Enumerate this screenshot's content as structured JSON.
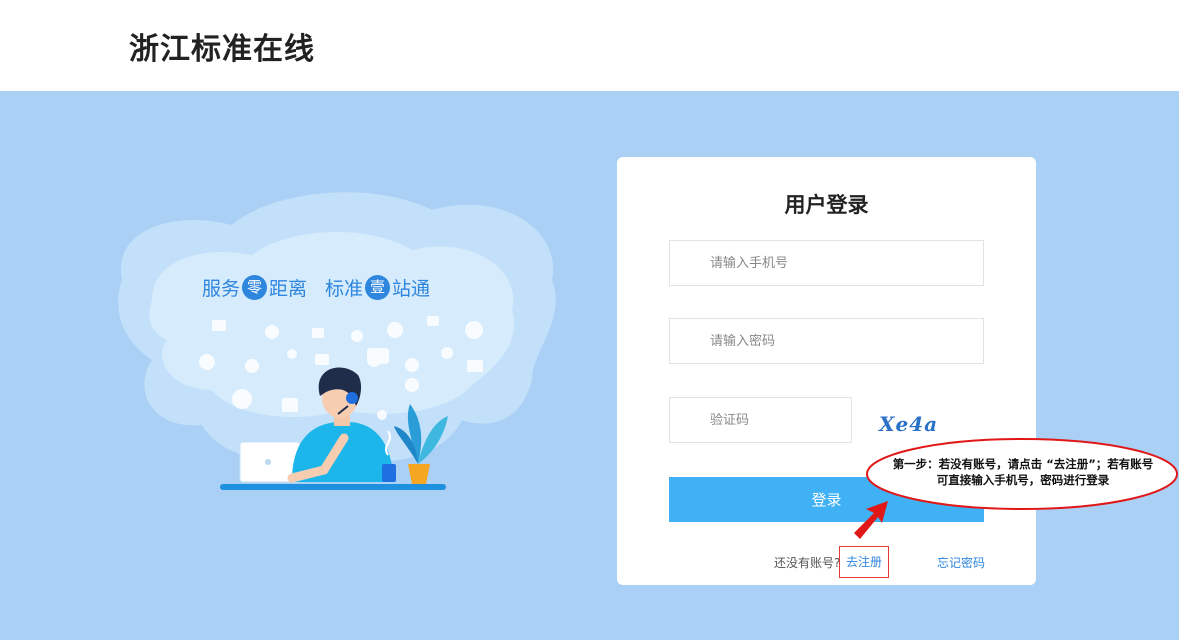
{
  "header": {
    "site_title": "浙江标准在线"
  },
  "hero": {
    "slogan": {
      "part1": "服务",
      "circle1": "零",
      "part2": "距离",
      "part3": "标准",
      "circle2": "壹",
      "part4": "站通"
    }
  },
  "login": {
    "title": "用户登录",
    "phone_placeholder": "请输入手机号",
    "password_placeholder": "请输入密码",
    "captcha_placeholder": "验证码",
    "captcha_code": "Xe4a",
    "submit_label": "登录",
    "no_account_text": "还没有账号?",
    "register_label": "去注册",
    "forgot_label": "忘记密码"
  },
  "annotation": {
    "line1": "第一步：若没有账号，请点击 “去注册”；若有账号",
    "line2": "可直接输入手机号，密码进行登录"
  },
  "colors": {
    "hero_background": "#aad0f5",
    "accent": "#3fb1f4",
    "link": "#2e86de",
    "annotation_red": "#e01818"
  }
}
